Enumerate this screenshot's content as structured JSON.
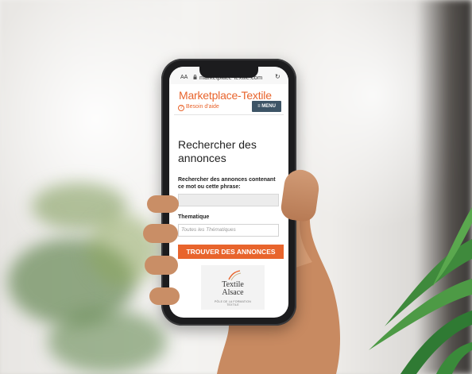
{
  "browser": {
    "aa_label": "AA",
    "url": "marketplace-textile.com",
    "reload_icon": "reload-icon",
    "lock_icon": "lock-icon"
  },
  "site": {
    "brand": "Marketplace-Textile",
    "help_label": "Besoin d'aide",
    "help_icon": "question-circle-icon",
    "menu_label": "MENU",
    "menu_icon": "hamburger-icon"
  },
  "search": {
    "title": "Rechercher des annonces",
    "phrase_label": "Rechercher des annonces contenant ce mot ou cette phrase:",
    "phrase_value": "",
    "theme_label": "Thematique",
    "theme_placeholder": "Toutes les Thématiques",
    "submit_label": "TROUVER DES ANNONCES"
  },
  "logo": {
    "line1": "Textile",
    "line2": "Alsace",
    "tagline": "PÔLE DE LA FORMATION TEXTILE"
  },
  "colors": {
    "accent": "#e8642c",
    "menu_bg": "#3d5466",
    "phone_body": "#1c1c1e"
  }
}
